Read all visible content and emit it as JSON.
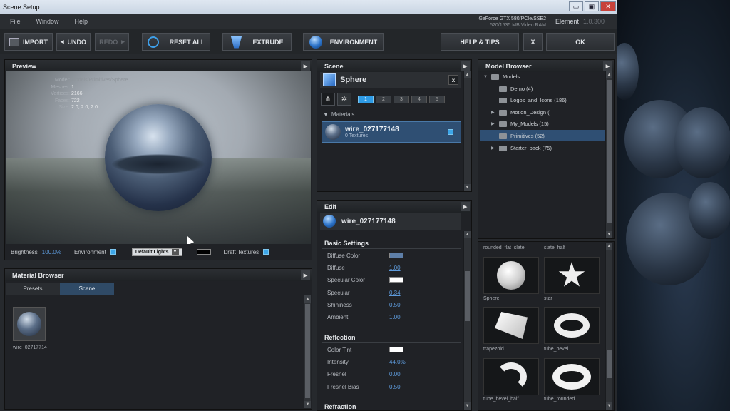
{
  "window": {
    "title": "Scene Setup",
    "btn_min": "▭",
    "btn_max": "▣",
    "btn_close": "✕"
  },
  "menu": [
    "File",
    "Window",
    "Help"
  ],
  "gpu": {
    "line1": "GeForce GTX 580/PCIe/SSE2",
    "line2": "520/1535 MB Video RAM"
  },
  "edition": {
    "name": "Element",
    "version": "1.0.300"
  },
  "toolbar": {
    "import": "IMPORT",
    "undo": "UNDO",
    "redo": "REDO",
    "reset_all": "RESET ALL",
    "extrude": "EXTRUDE",
    "environment": "ENVIRONMENT",
    "help_tips": "HELP & TIPS",
    "close": "X",
    "ok": "OK"
  },
  "preview": {
    "title": "Preview",
    "info": {
      "model_label": "Model:",
      "model": "Models/Primitives/Sphere",
      "meshes_label": "Meshes:",
      "meshes": "1",
      "vertices_label": "Vertices:",
      "vertices": "2166",
      "faces_label": "Faces:",
      "faces": "722",
      "size_label": "Size:",
      "size": "2.0, 2.0, 2.0"
    },
    "brightness_label": "Brightness",
    "brightness": "100.0%",
    "environment_label": "Environment",
    "lights": "Default Lights",
    "draft_label": "Draft Textures"
  },
  "material_browser": {
    "title": "Material Browser",
    "tabs": [
      "Presets",
      "Scene"
    ],
    "active_tab": "Scene",
    "items": [
      {
        "label": "wire_02717714"
      }
    ]
  },
  "scene": {
    "title": "Scene",
    "object": "Sphere",
    "close": "x",
    "pages": [
      "1",
      "2",
      "3",
      "4",
      "5"
    ],
    "materials_label": "Materials",
    "material": {
      "name": "wire_027177148",
      "textures": "0 Textures"
    }
  },
  "edit": {
    "title": "Edit",
    "material": "wire_027177148",
    "basic_settings": "Basic Settings",
    "props": [
      {
        "label": "Diffuse Color",
        "value": "",
        "swatch": "#5e7fa8"
      },
      {
        "label": "Diffuse",
        "value": "1.00"
      },
      {
        "label": "Specular Color",
        "value": "",
        "swatch": "#ffffff"
      },
      {
        "label": "Specular",
        "value": "0.34"
      },
      {
        "label": "Shininess",
        "value": "0.50"
      },
      {
        "label": "Ambient",
        "value": "1.00"
      }
    ],
    "reflection": "Reflection",
    "reflection_props": [
      {
        "label": "Color Tint",
        "value": "",
        "swatch": "#ffffff"
      },
      {
        "label": "Intensity",
        "value": "44.0%"
      },
      {
        "label": "Fresnel",
        "value": "0.00"
      },
      {
        "label": "Fresnel Bias",
        "value": "0.50"
      }
    ],
    "refraction": "Refraction"
  },
  "model_browser": {
    "title": "Model Browser",
    "tree": [
      {
        "label": "Models",
        "expanded": true
      },
      {
        "label": "Demo (4)"
      },
      {
        "label": "Logos_and_Icons (186)"
      },
      {
        "label": "Motion_Design (",
        "collapsed": true
      },
      {
        "label": "My_Models (15)",
        "collapsed": true
      },
      {
        "label": "Primitives (52)",
        "selected": true
      },
      {
        "label": "Starter_pack (75)",
        "collapsed": true
      }
    ],
    "top_labels": [
      "rounded_flat_slate",
      "slate_half"
    ],
    "thumbs": [
      {
        "label": "Sphere"
      },
      {
        "label": "star"
      },
      {
        "label": "trapezoid"
      },
      {
        "label": "tube_bevel"
      },
      {
        "label": "tube_bevel_half"
      },
      {
        "label": "tube_rounded"
      }
    ]
  },
  "colors": {
    "accent": "#2e9be6",
    "selection": "#2f4f73",
    "link": "#5e9bdc"
  }
}
